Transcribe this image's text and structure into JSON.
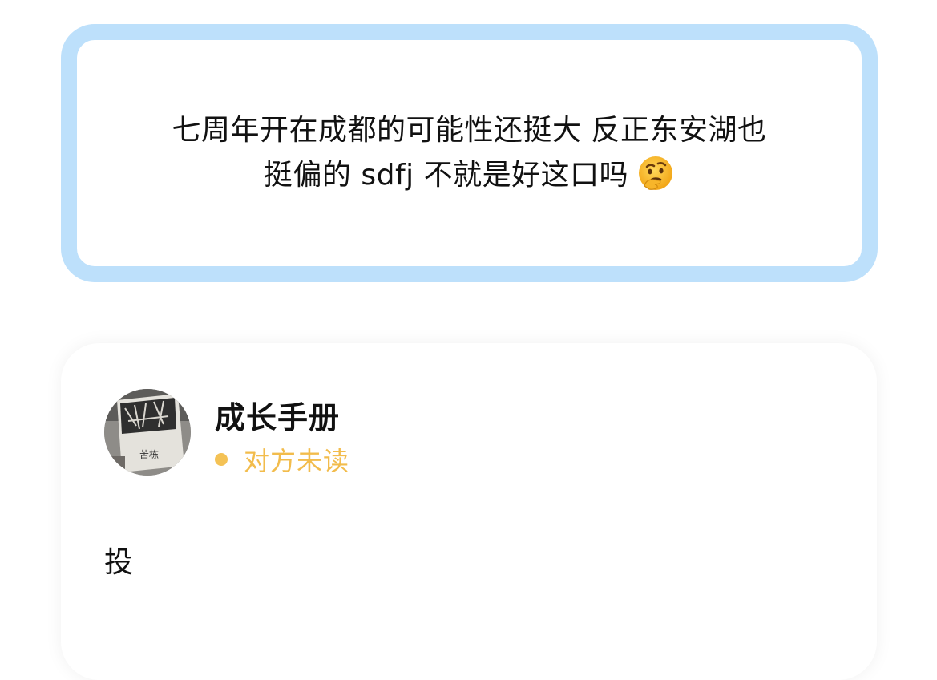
{
  "quote": {
    "line1": "七周年开在成都的可能性还挺大 反正东安湖也",
    "line2": "挺偏的 sdfj 不就是好这口吗",
    "emoji_icon": "thinking-face-emoji",
    "frame_color": "#bde0fb"
  },
  "note": {
    "sender_name": "成长手册",
    "status": "对方未读",
    "status_color": "#f2bc4c",
    "body": "投",
    "avatar_icon": "book-photo-avatar",
    "avatar_caption": "苦栋"
  }
}
